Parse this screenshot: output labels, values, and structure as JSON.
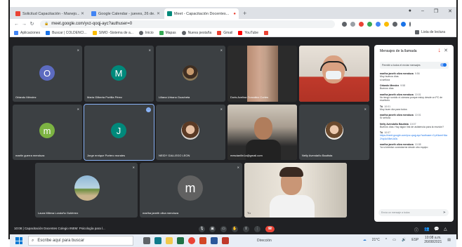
{
  "browser": {
    "tabs": [
      {
        "title": "Solicitud Capacitación - Manejo...",
        "color": "#ea4335",
        "active": false
      },
      {
        "title": "Google Calendar - jueves, 26 de...",
        "color": "#4285f4",
        "active": false
      },
      {
        "title": "Meet - Capacitación Docentes...",
        "color": "#00897b",
        "active": true
      }
    ],
    "new_tab": "+",
    "url": "meet.google.com/yvz-qoqj-ayc?authuser=0",
    "bookmarks": [
      "Aplicaciones",
      "Buscar | COLDENCI...",
      "SIMO -Sistema de a...",
      "Inicio",
      "Mapas",
      "Nueva pestaña",
      "Gmail",
      "YouTube"
    ],
    "reading_list": "Lista de lectura"
  },
  "participants": [
    {
      "name": "Orlando Méndez",
      "initial": "O",
      "color": "#5c6bc0",
      "type": "avatar"
    },
    {
      "name": "Maria Gilberta Portilla Pérez",
      "initial": "M",
      "color": "#00897b",
      "type": "avatar"
    },
    {
      "name": "Liliana Urbano Guacheta",
      "type": "photo"
    },
    {
      "name": "Doris Avelina González Cortes",
      "type": "video"
    },
    {
      "name": "martin guerra mendoza",
      "initial": "m",
      "color": "#7cb342",
      "type": "avatar"
    },
    {
      "name": "Jorge enrique Portero morales",
      "initial": "J",
      "color": "#00897b",
      "type": "avatar"
    },
    {
      "name": "NEIDY GALLEGO LEON",
      "type": "photo"
    },
    {
      "name": "mesdanilin1a@gmail.com",
      "type": "video"
    },
    {
      "name": "Nelly Avendaño Bautista",
      "type": "photo"
    },
    {
      "name": "Laura Milena Londoño Gutiérrez",
      "type": "photo"
    },
    {
      "name": "marlha janeth oliva mendoza",
      "initial": "m",
      "color": "#616161",
      "type": "avatar"
    },
    {
      "name": "Tú",
      "type": "video"
    }
  ],
  "chat": {
    "title": "Mensajes de la llamada",
    "toggle_label": "Permitir a todos el enviar mensajes",
    "messages": [
      {
        "who": "marlha janeth oliva mendoza",
        "time": "9:56",
        "text": "Muy buenos días"
      },
      {
        "who": "",
        "time": "",
        "text": "si señora"
      },
      {
        "who": "Orlando Mendez",
        "time": "9:58",
        "text": "Buenos días"
      },
      {
        "who": "marlha janeth oliva mendoza",
        "time": "10:01",
        "text": "No tengo sonido ni cámara porque estoy desde un PC de escritorio"
      },
      {
        "who": "Tú",
        "time": "10:01",
        "text": "Muy buen día para todos"
      },
      {
        "who": "marlha janeth oliva mendoza",
        "time": "10:01",
        "text": "Sí señora"
      },
      {
        "who": "Nelly Avendaño Bautista",
        "time": "10:07",
        "text": "Buenos días. Hay algún link de asistencia para la reunión?"
      },
      {
        "who": "Tú",
        "time": "10:07",
        "text": "https://meet.google.com/yvz-qoqj-ayc?authuser=0 pKkzmHAa2Vq4oX8mUk3v",
        "link": true
      },
      {
        "who": "marlha janeth oliva mendoza",
        "time": "10:08",
        "text": "Ya si intentar conectarme desde otro equipo"
      }
    ],
    "input_placeholder": "Envía un mensaje a todos"
  },
  "meeting_bar": {
    "time": "10:08",
    "title": "Capacitación Docentes Colegio INEM: Psicología para l..."
  },
  "taskbar": {
    "search_placeholder": "Escribe aquí para buscar",
    "direccion": "Dirección",
    "weather": "21°C",
    "lang": "ESP",
    "clock_time": "10:08 a.m.",
    "clock_date": "26/08/2021"
  }
}
